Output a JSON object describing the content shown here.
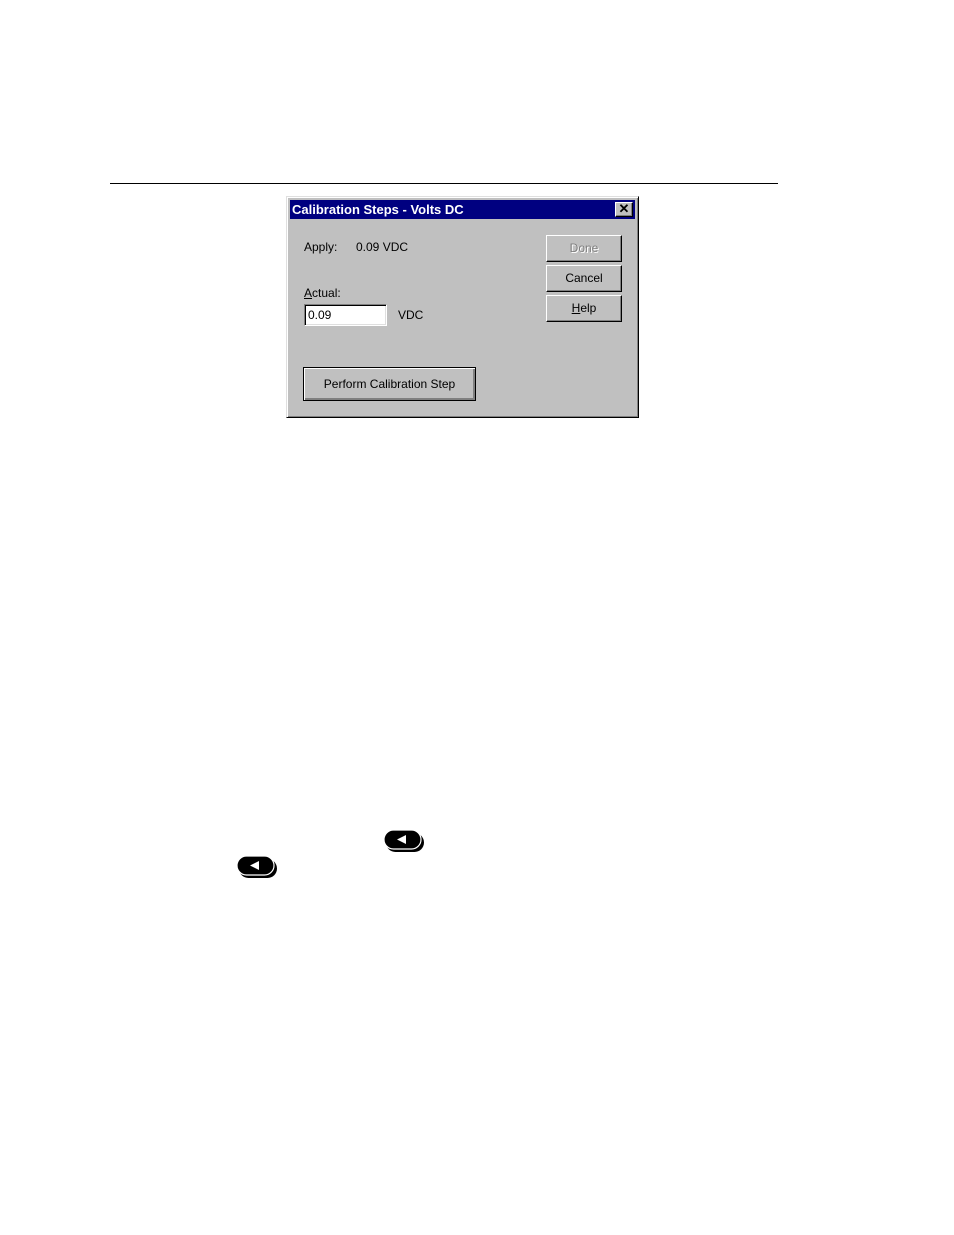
{
  "dialog": {
    "title": "Calibration Steps - Volts DC",
    "close_glyph": "✕",
    "apply_label": "Apply:",
    "apply_value": "0.09 VDC",
    "actual_label_mnemonic": "A",
    "actual_label_rest": "ctual:",
    "actual_value": "0.09",
    "actual_unit": "VDC",
    "buttons": {
      "done": "Done",
      "cancel": "Cancel",
      "help_mnemonic": "H",
      "help_rest": "elp",
      "perform": "Perform Calibration Step"
    }
  },
  "keys": [
    {
      "icon": "left-arrow-key-icon",
      "color": "#000000"
    },
    {
      "icon": "left-arrow-key-icon",
      "color": "#000000"
    }
  ]
}
